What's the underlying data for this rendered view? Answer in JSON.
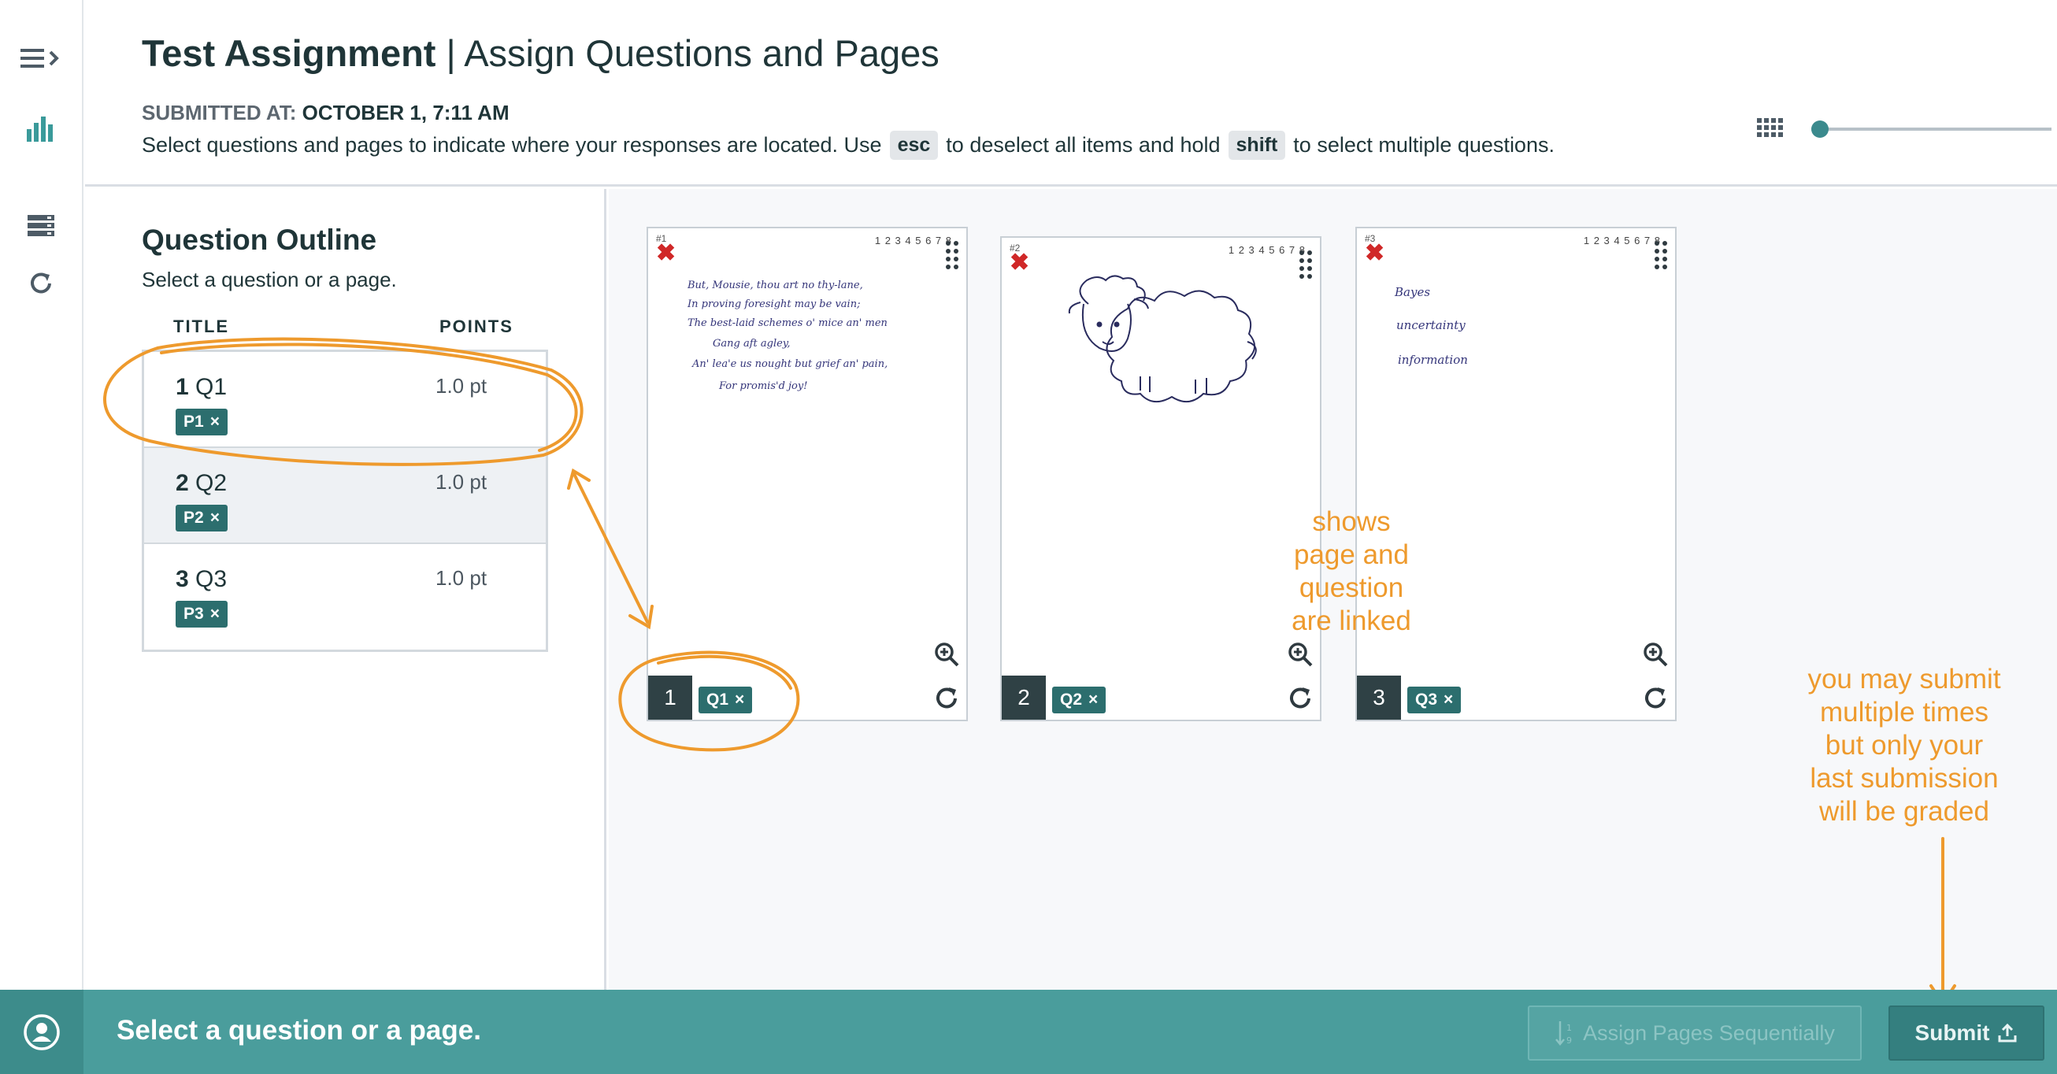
{
  "header": {
    "assignment_name": "Test Assignment",
    "separator": "|",
    "page_title": "Assign Questions and Pages",
    "submitted_label": "SUBMITTED AT:",
    "submitted_value": "OCTOBER 1, 7:11 AM",
    "instruction_part1": "Select questions and pages to indicate where your responses are located. Use",
    "key_esc": "esc",
    "instruction_part2": "to deselect all items and hold",
    "key_shift": "shift",
    "instruction_part3": "to select multiple questions."
  },
  "outline": {
    "heading": "Question Outline",
    "subheading": "Select a question or a page.",
    "col_title": "TITLE",
    "col_points": "POINTS",
    "questions": [
      {
        "number": "1",
        "name": "Q1",
        "points": "1.0 pt",
        "page_tag": "P1"
      },
      {
        "number": "2",
        "name": "Q2",
        "points": "1.0 pt",
        "page_tag": "P2"
      },
      {
        "number": "3",
        "name": "Q3",
        "points": "1.0 pt",
        "page_tag": "P3"
      }
    ]
  },
  "pages": [
    {
      "number": "1",
      "question_tag": "Q1",
      "page_id": "#1",
      "ruler": "1 2 3 4 5 6 7 8",
      "lines": [
        "But, Mousie, thou art no thy-lane,",
        "In proving foresight may be vain;",
        "The best-laid schemes o' mice an' men",
        "Gang aft agley,",
        "An' lea'e us nought but grief an' pain,",
        "For promis'd joy!"
      ]
    },
    {
      "number": "2",
      "question_tag": "Q2",
      "page_id": "#2",
      "ruler": "1 2 3 4 5 6 7 8"
    },
    {
      "number": "3",
      "question_tag": "Q3",
      "page_id": "#3",
      "ruler": "1 2 3 4 5 6 7 8",
      "lines": [
        "Bayes",
        "uncertainty",
        "information"
      ]
    }
  ],
  "annotations": {
    "linked_note": [
      "shows",
      "page and",
      "question",
      "are linked"
    ],
    "submit_note": [
      "you may submit",
      "multiple times",
      "but only your",
      "last submission",
      "will be graded"
    ]
  },
  "footer": {
    "message": "Select a question or a page.",
    "assign_sequential_label": "Assign Pages Sequentially",
    "submit_label": "Submit"
  },
  "colors": {
    "accent_teal": "#4a9d9c",
    "tag_teal": "#2c6e6e",
    "annotation_orange": "#ee9a2d",
    "remove_red": "#d02828"
  },
  "icons": {
    "rail": [
      "menu-expand-icon",
      "bar-chart-icon",
      "list-icon",
      "refresh-icon"
    ],
    "zoom": [
      "grid-icon",
      "single-page-icon"
    ]
  }
}
